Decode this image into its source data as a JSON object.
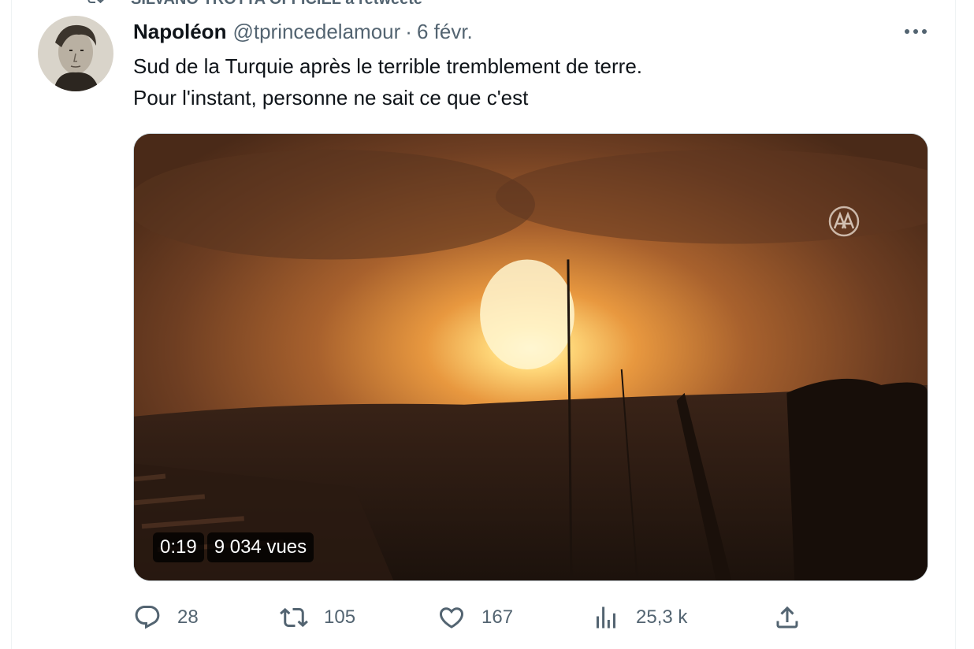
{
  "social_context": {
    "text": "SILVANO TROTTA OFFICIEL a retweeté"
  },
  "tweet": {
    "author": {
      "display_name": "Napoléon",
      "handle": "@tprincedelamour"
    },
    "separator": "·",
    "time": "6 févr.",
    "text_lines": [
      "Sud de la Turquie après le terrible tremblement de terre.",
      "Pour l'instant, personne ne sait ce que c'est"
    ],
    "media": {
      "duration": "0:19",
      "views_label": "9 034 vues",
      "watermark_icon": "aa-logo-icon"
    },
    "actions": {
      "replies": "28",
      "retweets": "105",
      "likes": "167",
      "views": "25,3 k"
    }
  },
  "colors": {
    "text_primary": "#0f1419",
    "text_secondary": "#536471",
    "border": "#cfd9de"
  }
}
